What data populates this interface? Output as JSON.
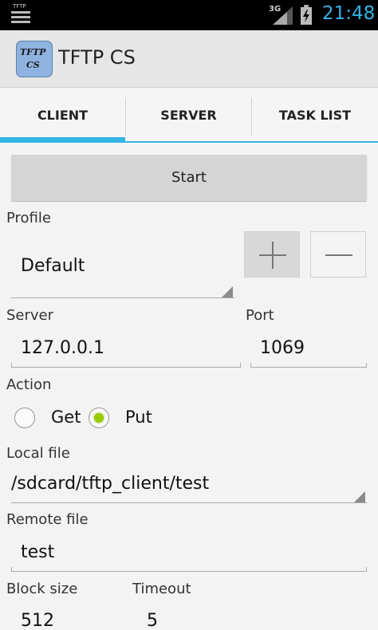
{
  "status_bar": {
    "notification_label": "TFTP",
    "network_type": "3G",
    "time": "21:48",
    "time_color": "#33b5e5",
    "icons": [
      "notification-list-icon",
      "signal-icon",
      "battery-charging-icon"
    ]
  },
  "action_bar": {
    "icon_line1": "TFTP",
    "icon_line2": "CS",
    "title": "TFTP CS"
  },
  "tabs": [
    {
      "label": "CLIENT",
      "selected": true
    },
    {
      "label": "SERVER",
      "selected": false
    },
    {
      "label": "TASK LIST",
      "selected": false
    }
  ],
  "accent_color": "#33b5e5",
  "start_button": "Start",
  "profile": {
    "label": "Profile",
    "value": "Default",
    "add_icon": "plus-icon",
    "remove_icon": "minus-icon"
  },
  "server": {
    "label": "Server",
    "value": "127.0.0.1"
  },
  "port": {
    "label": "Port",
    "value": "1069"
  },
  "action": {
    "label": "Action",
    "options": [
      {
        "label": "Get",
        "checked": false
      },
      {
        "label": "Put",
        "checked": true
      }
    ],
    "checked_color": "#99cc00"
  },
  "local_file": {
    "label": "Local file",
    "value": "/sdcard/tftp_client/test"
  },
  "remote_file": {
    "label": "Remote file",
    "value": "test"
  },
  "block_size": {
    "label": "Block size",
    "value": "512"
  },
  "timeout": {
    "label": "Timeout",
    "value": "5"
  }
}
